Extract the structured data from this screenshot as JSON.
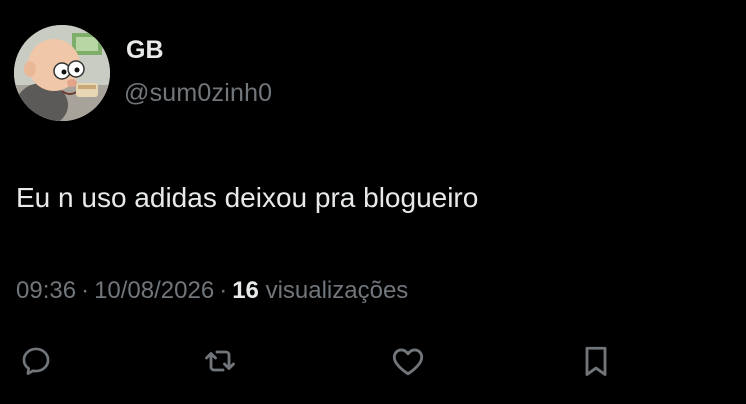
{
  "user": {
    "display_name": "GB",
    "handle": "@sum0zinh0",
    "avatar_icon": "avatar-cartoon-bald-man"
  },
  "tweet": {
    "text": "Eu n uso adidas deixou pra blogueiro",
    "time": "09:36",
    "date": "10/08/2026",
    "separator": "·",
    "views_count": "16",
    "views_label": "visualizações"
  },
  "actions": [
    {
      "name": "reply",
      "icon": "reply-icon"
    },
    {
      "name": "retweet",
      "icon": "retweet-icon"
    },
    {
      "name": "like",
      "icon": "heart-icon"
    },
    {
      "name": "bookmark",
      "icon": "bookmark-icon"
    }
  ],
  "colors": {
    "background": "#000000",
    "primary_text": "#e7e9ea",
    "secondary_text": "#71767b"
  }
}
